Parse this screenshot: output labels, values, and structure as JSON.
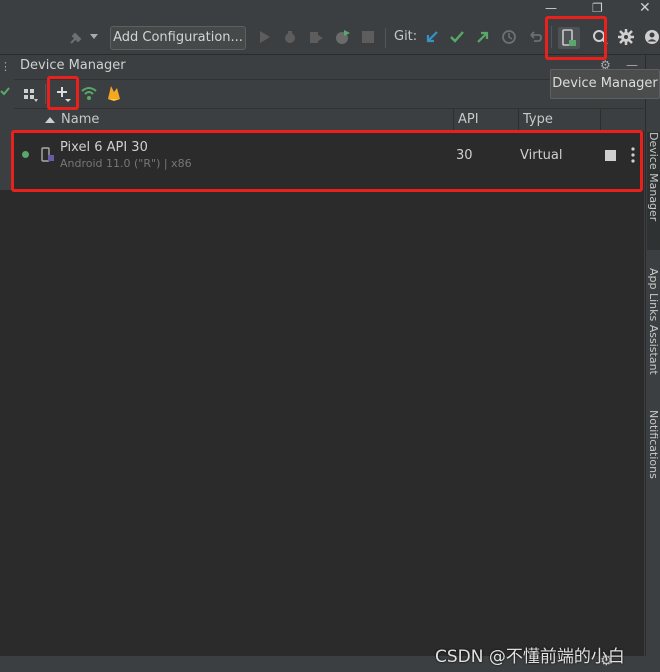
{
  "window": {
    "minimize_icon": "minimize-icon",
    "restore_icon": "restore-icon",
    "close_icon": "close-icon"
  },
  "toolbar": {
    "config_label": "Add Configuration...",
    "git_label": "Git:"
  },
  "panel": {
    "title": "Device Manager"
  },
  "table": {
    "columns": [
      "Name",
      "API",
      "Type"
    ],
    "rows": [
      {
        "name": "Pixel 6 API 30",
        "subtitle": "Android 11.0 (\"R\") | x86",
        "api": "30",
        "type": "Virtual",
        "status": "online"
      }
    ]
  },
  "tooltip": {
    "text": "Device Manager"
  },
  "right_tabs": [
    "Device Manager",
    "App Links Assistant",
    "Notifications"
  ],
  "watermark": "CSDN @不懂前端的小白",
  "colors": {
    "accent_green": "#59a869",
    "highlight_red": "#e8211c",
    "git_blue": "#3592c4"
  }
}
